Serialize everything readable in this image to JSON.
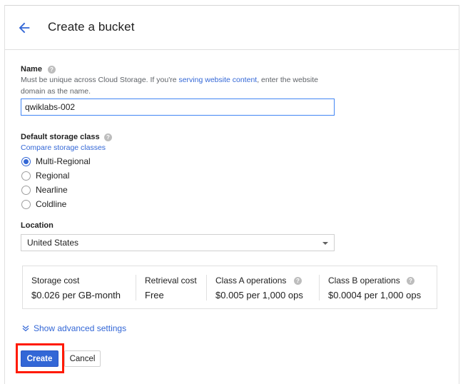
{
  "header": {
    "title": "Create a bucket",
    "back_icon": "arrow-back-icon"
  },
  "name_section": {
    "label": "Name",
    "desc_prefix": "Must be unique across Cloud Storage. If you're ",
    "desc_link": "serving website content",
    "desc_suffix": ", enter the website",
    "desc_line2": "domain as the name.",
    "value": "qwiklabs-002"
  },
  "storage_class": {
    "label": "Default storage class",
    "compare_link": "Compare storage classes",
    "options": [
      "Multi-Regional",
      "Regional",
      "Nearline",
      "Coldline"
    ],
    "selected": "Multi-Regional"
  },
  "location": {
    "label": "Location",
    "value": "United States"
  },
  "costs": [
    {
      "head": "Storage cost",
      "value": "$0.026 per GB-month"
    },
    {
      "head": "Retrieval cost",
      "value": "Free"
    },
    {
      "head": "Class A operations",
      "value": "$0.005 per 1,000 ops"
    },
    {
      "head": "Class B operations",
      "value": "$0.0004 per 1,000 ops"
    }
  ],
  "advanced_link": "Show advanced settings",
  "actions": {
    "create": "Create",
    "cancel": "Cancel"
  },
  "colors": {
    "accent": "#3367d6",
    "highlight": "#ff1a00"
  }
}
